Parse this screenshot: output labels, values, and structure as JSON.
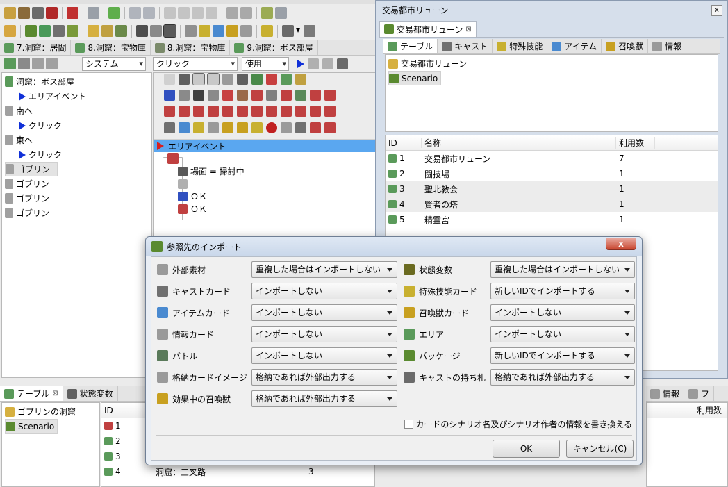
{
  "left_tabs": [
    {
      "label": "7.洞窟：居間"
    },
    {
      "label": "8.洞窟：宝物庫"
    },
    {
      "label": "8.洞窟：宝物庫"
    },
    {
      "label": "9.洞窟：ボス部屋"
    }
  ],
  "toolbar_combos": {
    "system": "システム",
    "click": "クリック",
    "use": "使用"
  },
  "event_tree": [
    {
      "label": "洞窟：ボス部屋",
      "indent": 0,
      "type": "area"
    },
    {
      "label": "エリアイベント",
      "indent": 1,
      "type": "event"
    },
    {
      "label": "南へ",
      "indent": 0,
      "type": "card"
    },
    {
      "label": "クリック",
      "indent": 1,
      "type": "event"
    },
    {
      "label": "東へ",
      "indent": 0,
      "type": "card"
    },
    {
      "label": "クリック",
      "indent": 1,
      "type": "event"
    },
    {
      "label": "ゴブリン",
      "indent": 0,
      "type": "card",
      "selected": true
    },
    {
      "label": "ゴブリン",
      "indent": 0,
      "type": "card"
    },
    {
      "label": "ゴブリン",
      "indent": 0,
      "type": "card"
    },
    {
      "label": "ゴブリン",
      "indent": 0,
      "type": "card"
    }
  ],
  "content_tree": {
    "header": "エリアイベント",
    "items": [
      {
        "label": "場面 = 掃討中"
      },
      {
        "label": "ＯＫ"
      },
      {
        "label": "ＯＫ"
      }
    ]
  },
  "right_window": {
    "title": "交易都市リューン",
    "tab": "交易都市リューン",
    "subtabs": [
      "テーブル",
      "キャスト",
      "特殊技能",
      "アイテム",
      "召喚獣",
      "情報"
    ],
    "tree": [
      {
        "label": "交易都市リューン"
      },
      {
        "label": "Scenario"
      }
    ],
    "columns": [
      "ID",
      "名称",
      "利用数"
    ],
    "rows": [
      {
        "id": "1",
        "name": "交易都市リューン",
        "count": "7"
      },
      {
        "id": "2",
        "name": "闘技場",
        "count": "1"
      },
      {
        "id": "3",
        "name": "聖北教会",
        "count": "1"
      },
      {
        "id": "4",
        "name": "賢者の塔",
        "count": "1"
      },
      {
        "id": "5",
        "name": "精霊宮",
        "count": "1"
      }
    ]
  },
  "bottom_left": {
    "tabs": [
      "テーブル",
      "状態変数"
    ],
    "tree": [
      {
        "label": "ゴブリンの洞窟"
      },
      {
        "label": "Scenario"
      }
    ],
    "id_header": "ID",
    "rows": [
      {
        "id": "1",
        "name": "",
        "count": ""
      },
      {
        "id": "2",
        "name": "",
        "count": ""
      },
      {
        "id": "3",
        "name": "",
        "count": ""
      },
      {
        "id": "4",
        "name": "洞窟：三叉路",
        "count": "3"
      }
    ]
  },
  "bottom_right": {
    "tabs": [
      "情報",
      "フ"
    ],
    "count_header": "利用数"
  },
  "dialog": {
    "title": "参照先のインポート",
    "close_label": "x",
    "fields_left": [
      {
        "label": "外部素材",
        "value": "重複した場合はインポートしない",
        "icon": "document-icon"
      },
      {
        "label": "キャストカード",
        "value": "インポートしない",
        "icon": "cast-icon"
      },
      {
        "label": "アイテムカード",
        "value": "インポートしない",
        "icon": "item-icon"
      },
      {
        "label": "情報カード",
        "value": "インポートしない",
        "icon": "info-icon"
      },
      {
        "label": "バトル",
        "value": "インポートしない",
        "icon": "battle-icon"
      },
      {
        "label": "格納カードイメージ",
        "value": "格納であれば外部出力する",
        "icon": "card-image-icon"
      },
      {
        "label": "効果中の召喚獣",
        "value": "格納であれば外部出力する",
        "icon": "summon-icon"
      }
    ],
    "fields_right": [
      {
        "label": "状態変数",
        "value": "重複した場合はインポートしない",
        "icon": "variable-icon"
      },
      {
        "label": "特殊技能カード",
        "value": "新しいIDでインポートする",
        "icon": "skill-icon"
      },
      {
        "label": "召喚獣カード",
        "value": "インポートしない",
        "icon": "summon-card-icon"
      },
      {
        "label": "エリア",
        "value": "インポートしない",
        "icon": "area-icon"
      },
      {
        "label": "パッケージ",
        "value": "新しいIDでインポートする",
        "icon": "package-icon"
      },
      {
        "label": "キャストの持ち札",
        "value": "格納であれば外部出力する",
        "icon": "hand-icon"
      }
    ],
    "checkbox_label": "カードのシナリオ名及びシナリオ作者の情報を書き換える",
    "ok_label": "OK",
    "cancel_label": "キャンセル(C)"
  },
  "colors": {
    "accent": "#3f9bf0",
    "event_red": "#d82020",
    "arrow_blue": "#1030d8",
    "dialog_bg": "#f0f0f0"
  }
}
